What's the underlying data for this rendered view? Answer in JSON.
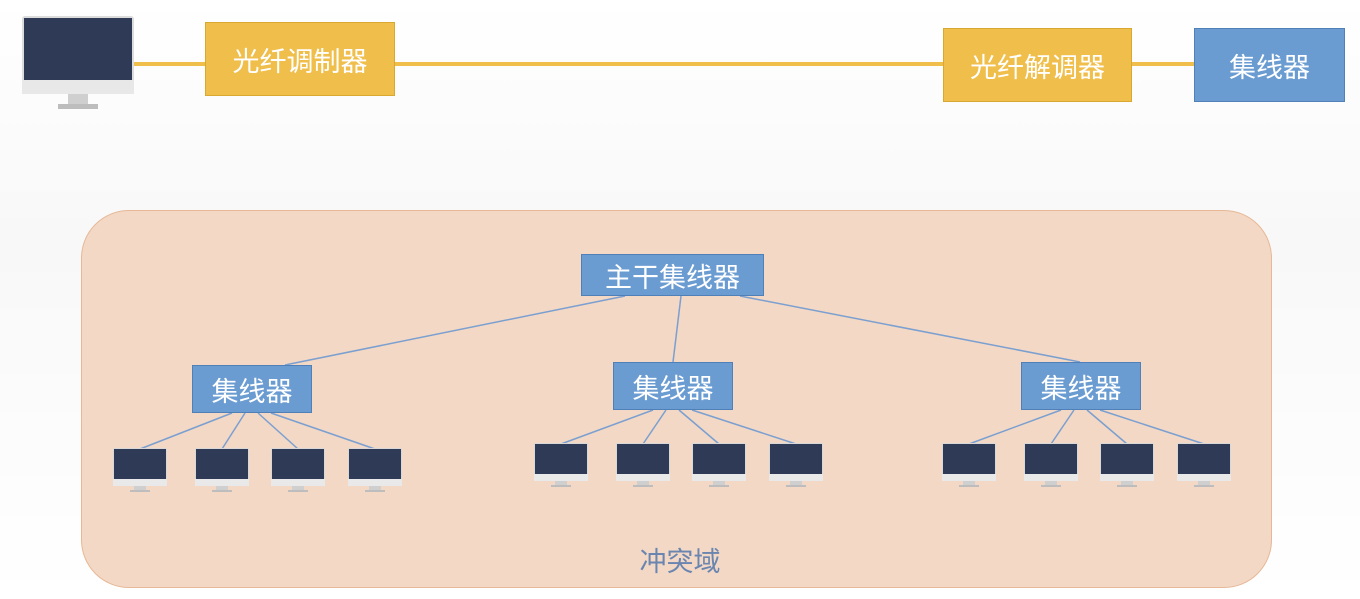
{
  "top_row": {
    "modulator_label": "光纤调制器",
    "demodulator_label": "光纤解调器",
    "hub_label": "集线器"
  },
  "network": {
    "backbone_label": "主干集线器",
    "hubs": [
      {
        "label": "集线器"
      },
      {
        "label": "集线器"
      },
      {
        "label": "集线器"
      }
    ],
    "domain_label": "冲突域"
  },
  "colors": {
    "fiber_line": "#f0be4b",
    "yellow_box": "#f0be4b",
    "blue_box": "#6a9bd1",
    "domain_fill": "#f2d8c5",
    "link_line": "#7b9fd0",
    "monitor_screen": "#2f3a57"
  }
}
